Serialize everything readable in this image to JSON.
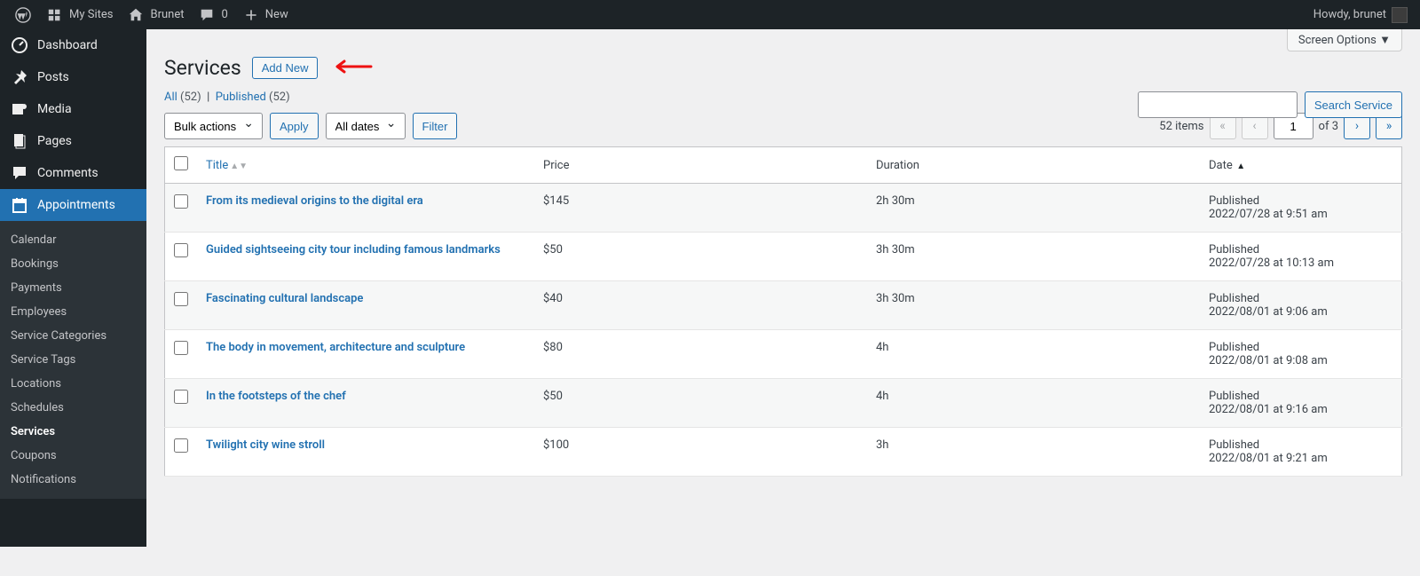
{
  "topbar": {
    "my_sites": "My Sites",
    "site_name": "Brunet",
    "comments_count": "0",
    "new_label": "New",
    "howdy": "Howdy, brunet"
  },
  "sidebar": {
    "items": [
      {
        "icon": "dashboard",
        "label": "Dashboard"
      },
      {
        "icon": "posts",
        "label": "Posts"
      },
      {
        "icon": "media",
        "label": "Media"
      },
      {
        "icon": "pages",
        "label": "Pages"
      },
      {
        "icon": "comments",
        "label": "Comments"
      },
      {
        "icon": "appointments",
        "label": "Appointments"
      }
    ],
    "submenu": [
      "Calendar",
      "Bookings",
      "Payments",
      "Employees",
      "Service Categories",
      "Service Tags",
      "Locations",
      "Schedules",
      "Services",
      "Coupons",
      "Notifications"
    ],
    "active_sub": "Services"
  },
  "page": {
    "title": "Services",
    "add_new": "Add New",
    "screen_options": "Screen Options"
  },
  "filters": {
    "all_label": "All",
    "all_count": "(52)",
    "published_label": "Published",
    "published_count": "(52)"
  },
  "controls": {
    "bulk_actions": "Bulk actions",
    "apply": "Apply",
    "all_dates": "All dates",
    "filter": "Filter",
    "search_btn": "Search Service"
  },
  "pagination": {
    "items_label": "52 items",
    "current_page": "1",
    "of_label": "of 3"
  },
  "table": {
    "columns": {
      "title": "Title",
      "price": "Price",
      "duration": "Duration",
      "date": "Date"
    },
    "rows": [
      {
        "title": "From its medieval origins to the digital era",
        "price": "$145",
        "duration": "2h 30m",
        "status": "Published",
        "date": "2022/07/28 at 9:51 am"
      },
      {
        "title": "Guided sightseeing city tour including famous landmarks",
        "price": "$50",
        "duration": "3h 30m",
        "status": "Published",
        "date": "2022/07/28 at 10:13 am"
      },
      {
        "title": "Fascinating cultural landscape",
        "price": "$40",
        "duration": "3h 30m",
        "status": "Published",
        "date": "2022/08/01 at 9:06 am"
      },
      {
        "title": "The body in movement, architecture and sculpture",
        "price": "$80",
        "duration": "4h",
        "status": "Published",
        "date": "2022/08/01 at 9:08 am"
      },
      {
        "title": "In the footsteps of the chef",
        "price": "$50",
        "duration": "4h",
        "status": "Published",
        "date": "2022/08/01 at 9:16 am"
      },
      {
        "title": "Twilight city wine stroll",
        "price": "$100",
        "duration": "3h",
        "status": "Published",
        "date": "2022/08/01 at 9:21 am"
      }
    ]
  }
}
